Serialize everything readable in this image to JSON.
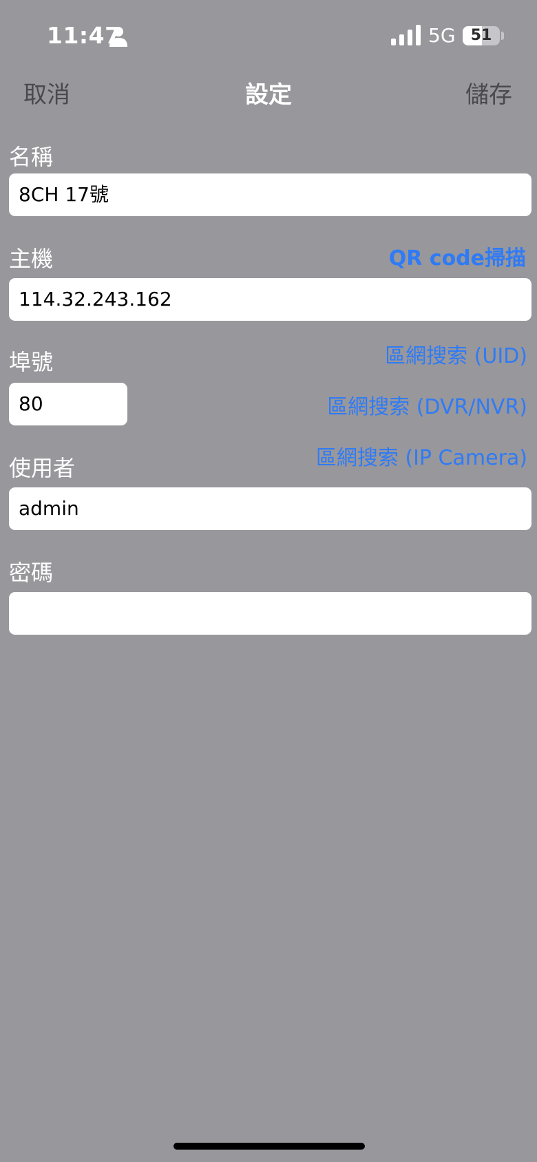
{
  "status_bar": {
    "time": "11:47",
    "network": "5G",
    "battery_level": "51",
    "battery_fraction": 0.51,
    "icons": [
      "person-icon",
      "signal-bars-icon",
      "battery-icon"
    ]
  },
  "nav": {
    "cancel_label": "取消",
    "title": "設定",
    "save_label": "儲存"
  },
  "form": {
    "name": {
      "label": "名稱",
      "value": "8CH 17號"
    },
    "host": {
      "label": "主機",
      "value": "114.32.243.162",
      "qr_link": "QR code掃描"
    },
    "port": {
      "label": "埠號",
      "value": "80"
    },
    "user": {
      "label": "使用者",
      "value": "admin"
    },
    "password": {
      "label": "密碼",
      "value": ""
    },
    "lan_search": {
      "uid": "區網搜索 (UID)",
      "dvr_nvr": "區網搜索 (DVR/NVR)",
      "ip_camera": "區網搜索 (IP Camera)"
    }
  },
  "colors": {
    "background": "#98979c",
    "link": "#2f7bf5",
    "field": "#ffffff"
  }
}
